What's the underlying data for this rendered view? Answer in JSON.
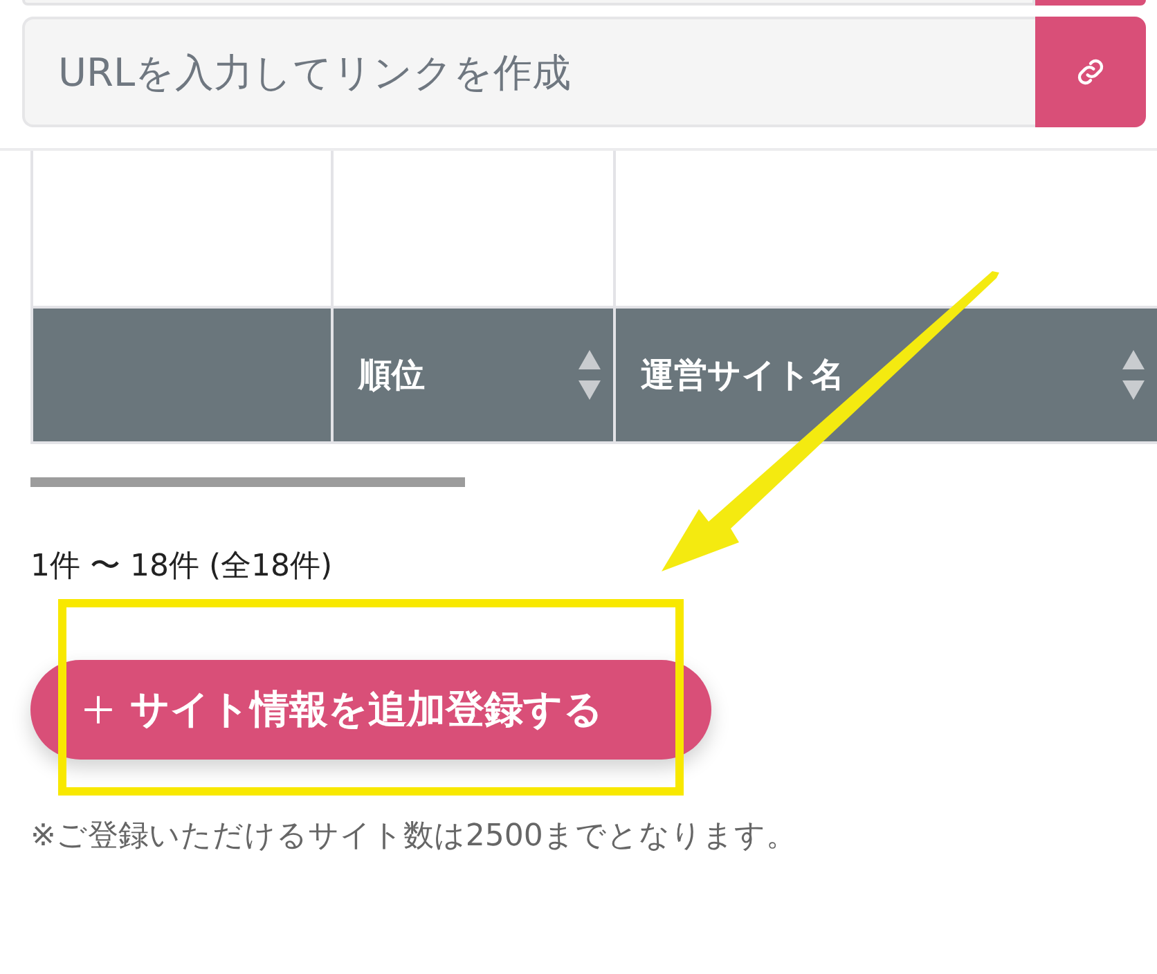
{
  "url_field": {
    "placeholder": "URLを入力してリンクを作成"
  },
  "table": {
    "columns": [
      {
        "kind": "blank"
      },
      {
        "kind": "sortable",
        "label": "順位"
      },
      {
        "kind": "sortable",
        "label": "運営サイト名"
      }
    ]
  },
  "pagination": "1件 〜 18件 (全18件)",
  "add_button": {
    "label": "サイト情報を追加登録する"
  },
  "note": "※ご登録いただけるサイト数は2500までとなります。"
}
